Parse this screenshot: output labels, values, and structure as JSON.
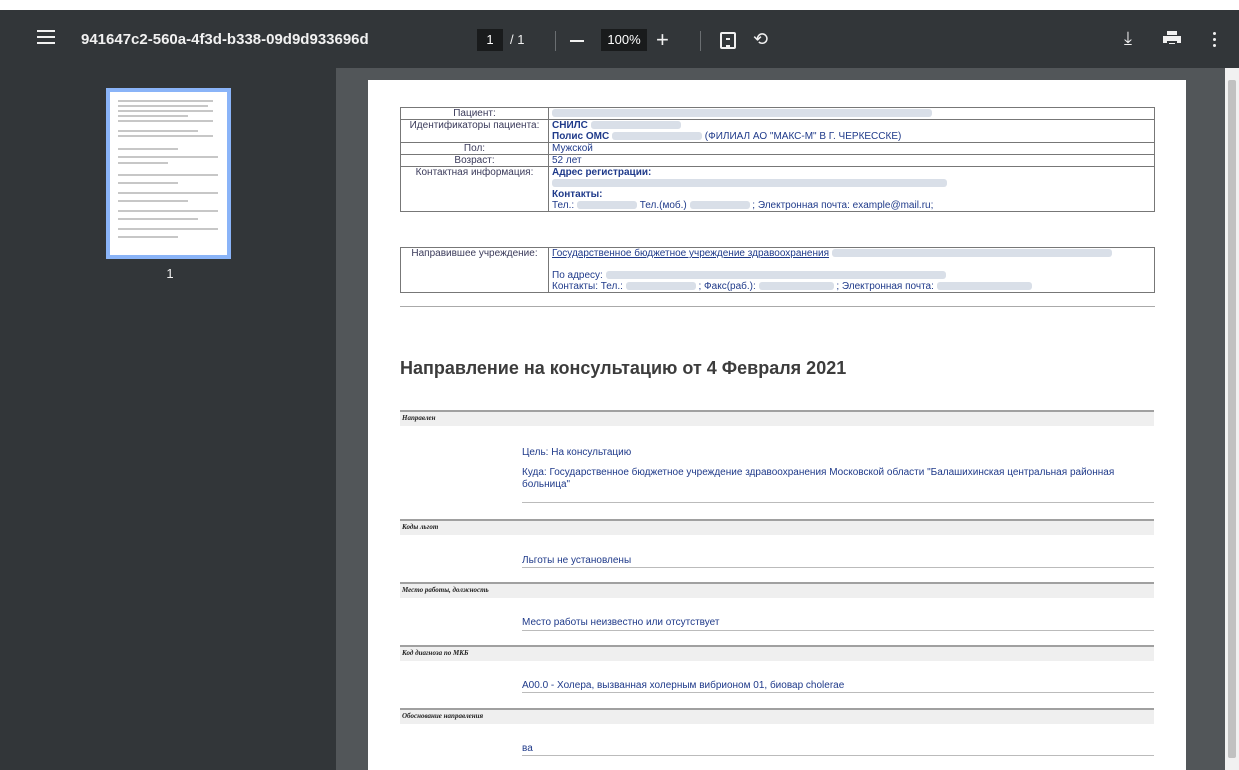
{
  "toolbar": {
    "doc_title": "941647c2-560a-4f3d-b338-09d9d933696d",
    "page_current": "1",
    "page_total": "/ 1",
    "zoom": "100%",
    "zoom_out_icon": "minus-icon",
    "zoom_in_label": "+",
    "fit_icon": "fit-page-icon",
    "rotate_label": "⟲",
    "download_label": "⤓",
    "print_icon": "print-icon",
    "more_icon": "kebab-menu-icon"
  },
  "sidebar": {
    "thumbnail_label": "1"
  },
  "patient": {
    "rows": [
      {
        "label": "Пациент:"
      },
      {
        "label": "Идентификаторы пациента:",
        "line1": "СНИЛС",
        "line2_bold": "Полис ОМС",
        "line2_rest": "(ФИЛИАЛ АО \"МАКС-М\" В Г. ЧЕРКЕССКЕ)"
      },
      {
        "label": "Пол:",
        "value": "Мужской"
      },
      {
        "label": "Возраст:",
        "value": "52 лет"
      },
      {
        "label": "Контактная информация:",
        "addr": "Адрес регистрации:",
        "contacts": "Контакты:",
        "tel": "Тел.:",
        "mob": "Тел.(моб.)",
        "email": "; Электронная почта: example@mail.ru;"
      }
    ]
  },
  "referrer": {
    "label": "Направившее учреждение:",
    "name": "Государственное бюджетное учреждение здравоохранения",
    "address": "По адресу:",
    "contacts": "Контакты: Тел.:",
    "fax": "; Факс(раб.):",
    "email": "; Электронная почта:"
  },
  "document": {
    "title": "Направление на консультацию от 4 Февраля 2021",
    "sections": [
      {
        "title": "Направлен",
        "lines": [
          "Цель: На консультацию",
          "Куда: Государственное бюджетное учреждение здравоохранения Московской области \"Балашихинская центральная районная",
          "больница\""
        ]
      },
      {
        "title": "Коды льгот",
        "lines": [
          "Льготы не установлены"
        ]
      },
      {
        "title": "Место работы, должность",
        "lines": [
          "Место работы неизвестно или отсутствует"
        ]
      },
      {
        "title": "Код диагноза по МКБ",
        "lines": [
          "A00.0 - Холера, вызванная холерным вибрионом 01, биовар cholerae"
        ]
      },
      {
        "title": "Обоснование направления",
        "lines": [
          "ва"
        ]
      }
    ]
  }
}
